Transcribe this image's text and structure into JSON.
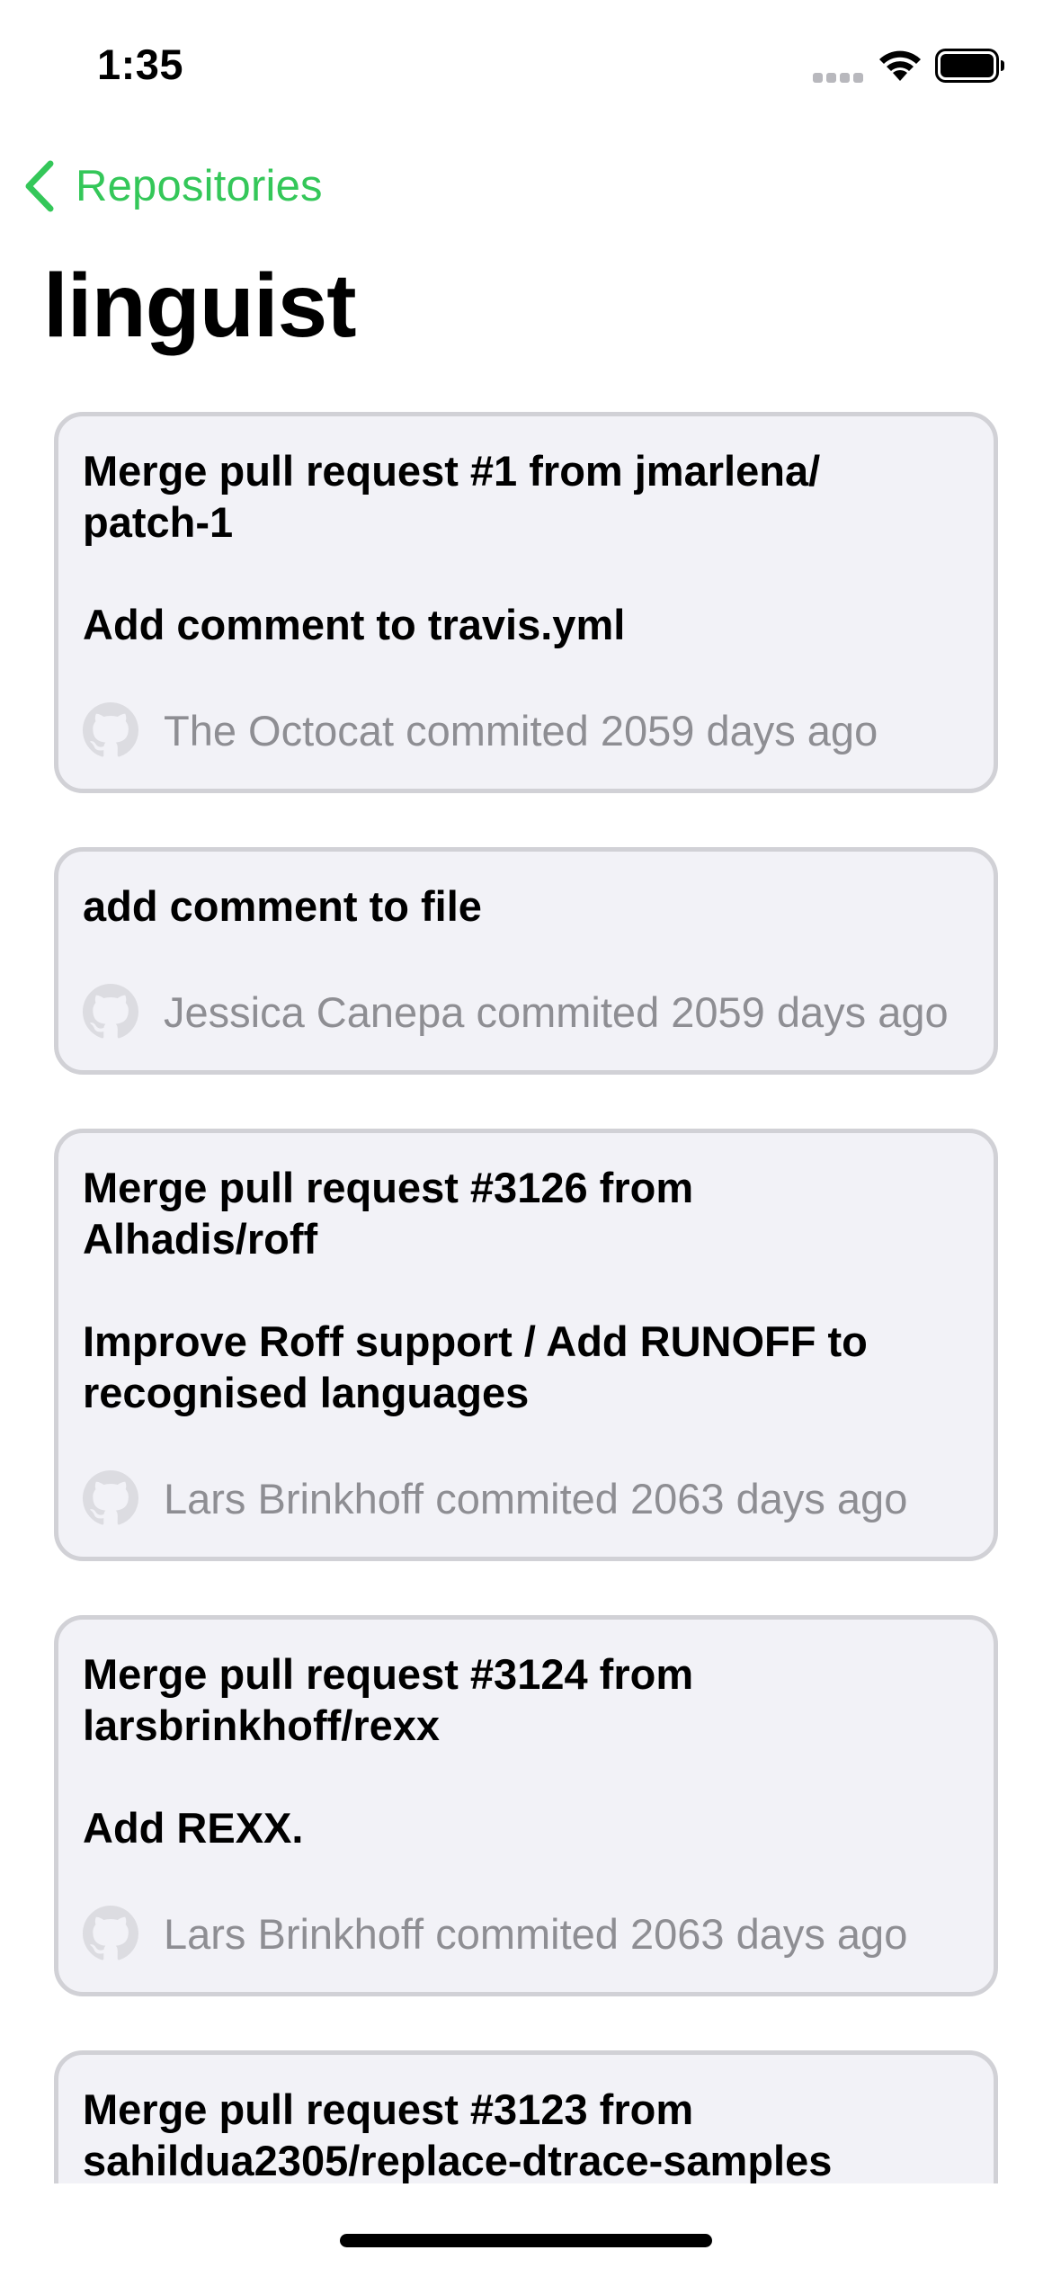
{
  "status_bar": {
    "time": "1:35"
  },
  "nav": {
    "back_label": "Repositories",
    "title": "linguist"
  },
  "colors": {
    "accent": "#34c759",
    "card_background": "#f2f2f7",
    "card_border": "#d1d1d6",
    "secondary_text": "#8e8e93"
  },
  "commits": [
    {
      "message": "Merge pull request #1 from jmarlena/\npatch-1\n\nAdd comment to travis.yml",
      "author": "The Octocat",
      "meta": "commited 2059 days ago",
      "avatar_icon": "github-icon"
    },
    {
      "message": "add comment to file",
      "author": "Jessica Canepa",
      "meta": "commited 2059 days ago",
      "avatar_icon": "github-icon"
    },
    {
      "message": "Merge pull request #3126 from\nAlhadis/roff\n\nImprove Roff support / Add RUNOFF to\nrecognised languages",
      "author": "Lars Brinkhoff",
      "meta": "commited 2063 days ago",
      "avatar_icon": "github-icon"
    },
    {
      "message": "Merge pull request #3124 from\nlarsbrinkhoff/rexx\n\nAdd REXX.",
      "author": "Lars Brinkhoff",
      "meta": "commited 2063 days ago",
      "avatar_icon": "github-icon"
    },
    {
      "message": "Merge pull request #3123 from\nsahildua2305/replace-dtrace-samples",
      "author": "",
      "meta": "",
      "avatar_icon": "github-icon"
    }
  ]
}
